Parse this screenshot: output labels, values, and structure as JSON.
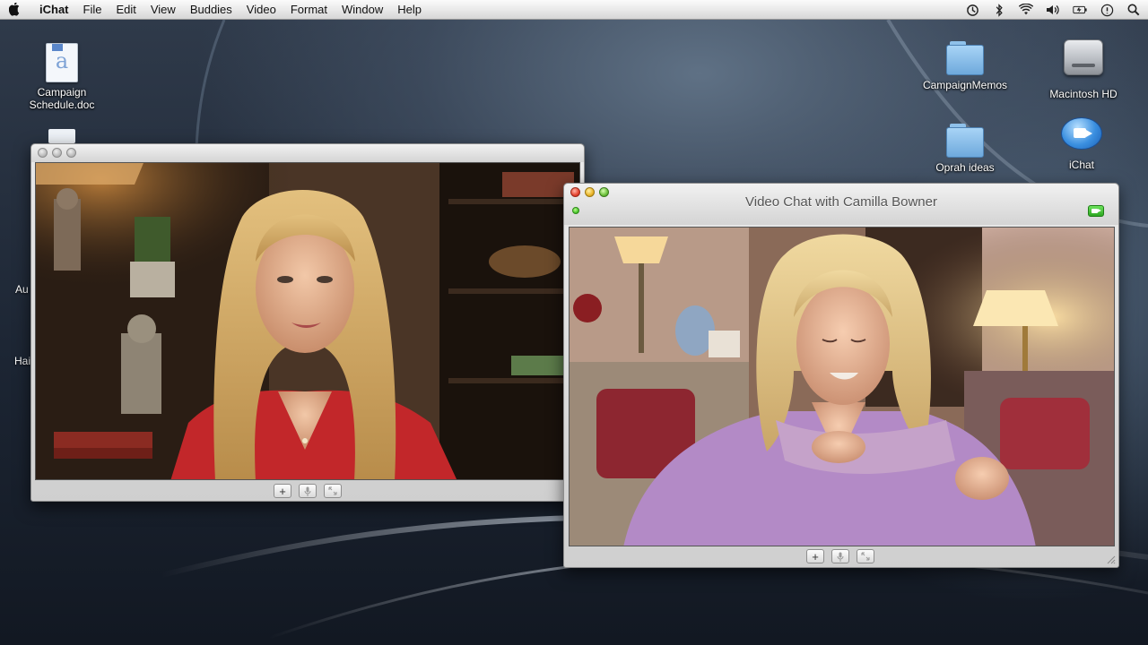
{
  "menubar": {
    "app_name": "iChat",
    "menus": [
      "File",
      "Edit",
      "View",
      "Buddies",
      "Video",
      "Format",
      "Window",
      "Help"
    ],
    "extras": [
      "time-machine-icon",
      "bluetooth-icon",
      "wifi-icon",
      "volume-icon",
      "battery-icon",
      "sync-icon",
      "spotlight-icon"
    ]
  },
  "desktop": {
    "icons": {
      "campaign_schedule": "Campaign\nSchedule.doc",
      "campaign_memos": "CampaignMemos",
      "macintosh_hd": "Macintosh HD",
      "oprah_ideas": "Oprah ideas",
      "ichat": "iChat"
    },
    "fragments": [
      "Au",
      "Hai"
    ]
  },
  "local_window": {
    "controls": [
      "add-icon",
      "mute-icon",
      "fullscreen-icon"
    ]
  },
  "chat_window": {
    "title": "Video Chat with Camilla Bowner",
    "controls": [
      "add-icon",
      "mute-icon",
      "fullscreen-icon"
    ]
  },
  "colors": {
    "desktop_blue": "#1c2533",
    "status_green": "#3fbf25",
    "close_red": "#e4432e"
  }
}
